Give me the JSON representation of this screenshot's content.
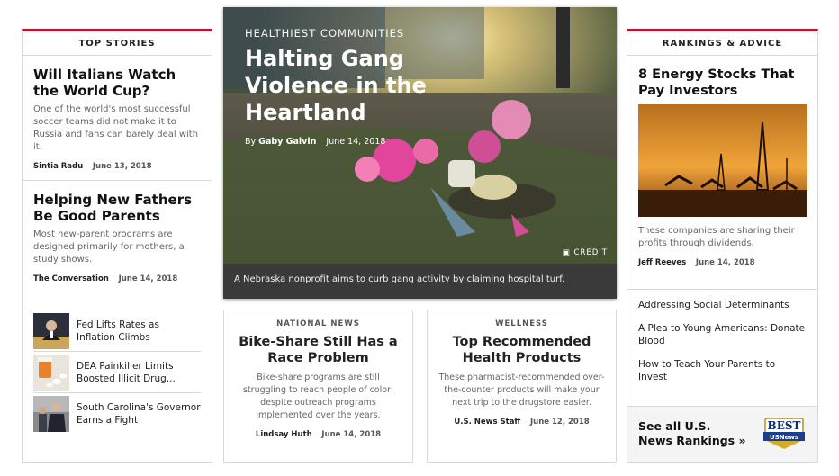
{
  "left": {
    "header": "TOP STORIES",
    "stories": [
      {
        "title": "Will Italians Watch the World Cup?",
        "dek": "One of the world's most successful soccer teams did not make it to Russia and fans can barely deal with it.",
        "author": "Sintia Radu",
        "date": "June 13, 2018"
      },
      {
        "title": "Helping New Fathers Be Good Parents",
        "dek": "Most new-parent programs are designed primarily for mothers, a study shows.",
        "author": "The Conversation",
        "date": "June 14, 2018"
      }
    ],
    "mini": [
      {
        "title": "Fed Lifts Rates as Inflation Climbs"
      },
      {
        "title": "DEA Painkiller Limits Boosted Illicit Drug..."
      },
      {
        "title": "South Carolina's Governor Earns a Fight"
      }
    ]
  },
  "hero": {
    "category": "HEALTHIEST COMMUNITIES",
    "title": "Halting Gang Violence in the Heartland",
    "by_prefix": "By",
    "author": "Gaby Galvin",
    "date": "June 14, 2018",
    "credit": "CREDIT",
    "caption": "A Nebraska nonprofit aims to curb gang activity by claiming hospital turf."
  },
  "cards": [
    {
      "kicker": "NATIONAL NEWS",
      "title": "Bike-Share Still Has a Race Problem",
      "dek": "Bike-share programs are still struggling to reach people of color, despite outreach programs implemented over the years.",
      "author": "Lindsay Huth",
      "date": "June 14, 2018"
    },
    {
      "kicker": "WELLNESS",
      "title": "Top Recommended Health Products",
      "dek": "These pharmacist-recommended over-the-counter products will make your next trip to the drugstore easier.",
      "author": "U.S. News Staff",
      "date": "June 12, 2018"
    }
  ],
  "right": {
    "header": "RANKINGS & ADVICE",
    "story": {
      "title": "8 Energy Stocks That Pay Investors",
      "dek": "These companies are sharing their profits through dividends.",
      "author": "Jeff Reeves",
      "date": "June 14, 2018"
    },
    "links": [
      "Addressing Social Determinants",
      "A Plea to Young Americans: Donate Blood",
      "How to Teach Your Parents to Invest"
    ],
    "see_all": "See all U.S. News Rankings »",
    "badge": {
      "line1": "BEST",
      "line2": "USNews"
    }
  },
  "colors": {
    "accent": "#c8102e",
    "caption_bg": "#3a3a3a"
  }
}
